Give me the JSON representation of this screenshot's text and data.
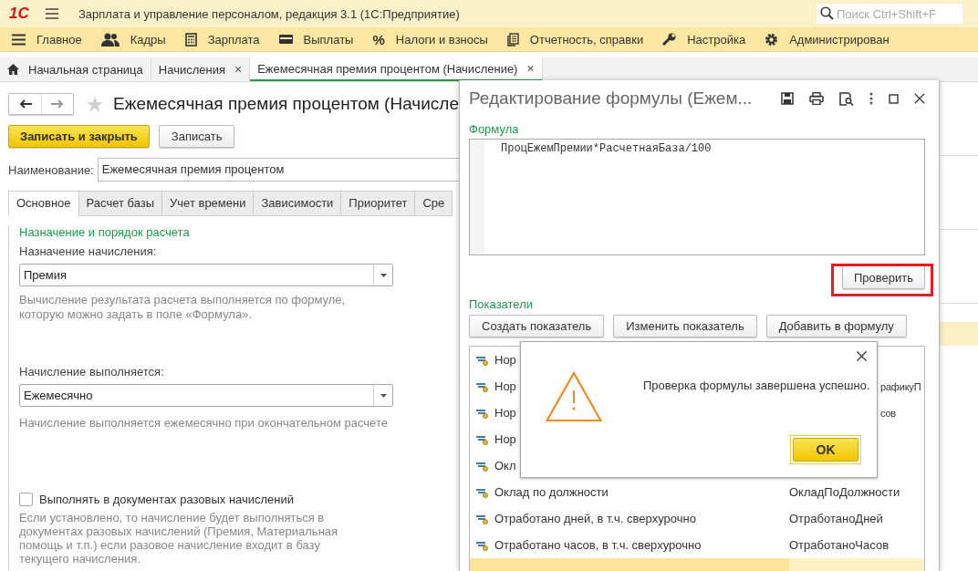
{
  "app_bar": {
    "logo": "1С",
    "title": "Зарплата и управление персоналом, редакция 3.1  (1С:Предприятие)",
    "search": {
      "placeholder": "Поиск Ctrl+Shift+F"
    }
  },
  "sections": [
    {
      "label": "Главное"
    },
    {
      "label": "Кадры"
    },
    {
      "label": "Зарплата"
    },
    {
      "label": "Выплаты"
    },
    {
      "label": "Налоги и взносы",
      "glyph": "%"
    },
    {
      "label": "Отчетность, справки"
    },
    {
      "label": "Настройка"
    },
    {
      "label": "Администрирован"
    }
  ],
  "tabs": [
    {
      "label": "Начальная страница",
      "selected": false
    },
    {
      "label": "Начисления",
      "close": "×",
      "selected": false
    },
    {
      "label": "Ежемесячная премия процентом (Начисление)",
      "close": "×",
      "selected": true
    }
  ],
  "form": {
    "title": "Ежемесячная премия процентом (Начисле",
    "buttons": [
      {
        "label": "Записать и закрыть",
        "primary": true
      },
      {
        "label": "Записать",
        "primary": false
      }
    ],
    "name_label": "Наименование:",
    "name_value": "Ежемесячная премия процентом",
    "tabs": [
      {
        "label": "Основное",
        "selected": true
      },
      {
        "label": "Расчет базы",
        "selected": false
      },
      {
        "label": "Учет времени",
        "selected": false
      },
      {
        "label": "Зависимости",
        "selected": false
      },
      {
        "label": "Приоритет",
        "selected": false
      },
      {
        "label": "Сре",
        "selected": false
      }
    ],
    "group_title": "Назначение и порядок расчета",
    "purpose_label": "Назначение начисления:",
    "purpose_value": "Премия",
    "purpose_hint": "Вычисление результата расчета выполняется по формуле,\nкоторую можно задать в поле «Формула».",
    "mode_label": "Начисление выполняется:",
    "mode_value": "Ежемесячно",
    "mode_hint": "Начисление выполняется ежемесячно при окончательном расчете",
    "one_time": {
      "label": "Выполнять в документах разовых начислений",
      "checked": false
    },
    "one_time_hint": "Если установлено, то начисление будет выполняться в\nдокументах разовых начислений (Премия, Материальная\nпомощь и т.п.) если разовое начисление входит в базу\nтекущего начисления."
  },
  "formula_dialog": {
    "title": "Редактирование формулы (Ежем...",
    "formula_label": "Формула",
    "formula": "ПроцЕжемПремии*РасчетнаяБаза/100",
    "check_button": "Проверить",
    "check_highlighted": true,
    "indicators_label": "Показатели",
    "buttons": [
      "Создать показатель",
      "Изменить показатель",
      "Добавить в формулу"
    ],
    "rows": [
      {
        "kind": "partial",
        "name": "Нор",
        "selected": false
      },
      {
        "kind": "partial",
        "name": "Нор",
        "code": "рафикуП",
        "selected": false
      },
      {
        "kind": "partial",
        "name": "Нор",
        "code": "сов",
        "selected": false
      },
      {
        "kind": "partial",
        "name": "Нор",
        "selected": false
      },
      {
        "kind": "partial",
        "name": "Окл",
        "selected": false
      },
      {
        "kind": "full",
        "name": "Оклад по должности",
        "code": "ОкладПоДолжности",
        "selected": false
      },
      {
        "kind": "full",
        "name": "Отработано дней, в т.ч. сверхурочно",
        "code": "ОтработаноДней",
        "selected": false
      },
      {
        "kind": "full",
        "name": "Отработано часов, в т.ч. сверхурочно",
        "code": "ОтработаноЧасов",
        "selected": false
      },
      {
        "kind": "full",
        "selected": true
      }
    ]
  },
  "message_box": {
    "text": "Проверка формулы завершена успешно.",
    "ok": "OK"
  }
}
